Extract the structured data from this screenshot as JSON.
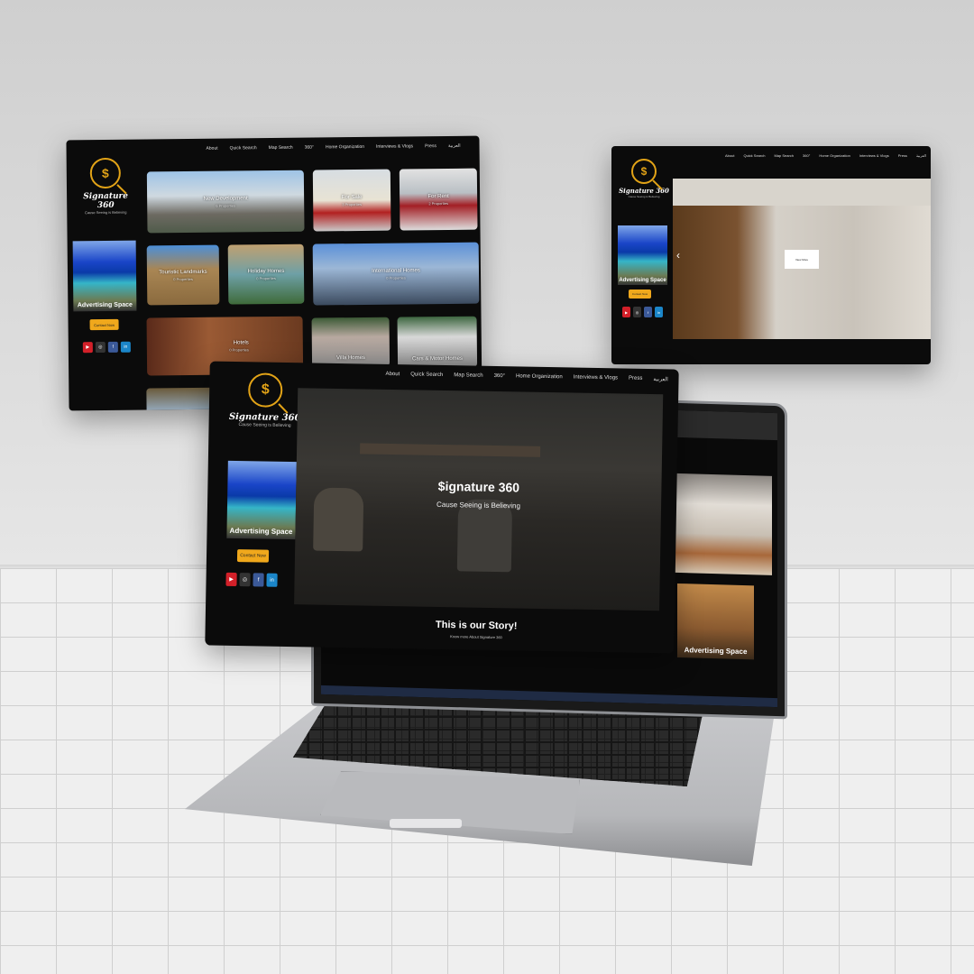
{
  "site": {
    "brand": "Signature 360",
    "tagline": "Cause Seeing is Believing",
    "hero_title": "$ignature 360",
    "hero_subtitle": "Cause Seeing is Believing",
    "story_title": "This is our Story!",
    "story_subtitle": "Know more About Signature 360",
    "logo_symbol": "$"
  },
  "nav": [
    "About",
    "Quick Search",
    "Map Search",
    "360°",
    "Home Organization",
    "Interviews & Vlogs",
    "Press",
    "العربية"
  ],
  "sidebar": {
    "ad_label": "Advertising Space",
    "contact_label": "Contact Now",
    "socials": [
      {
        "name": "youtube",
        "glyph": "▶",
        "color": "#d32029"
      },
      {
        "name": "instagram",
        "glyph": "◎",
        "color": "#333333"
      },
      {
        "name": "facebook",
        "glyph": "f",
        "color": "#3b5998"
      },
      {
        "name": "linkedin",
        "glyph": "in",
        "color": "#1b86c9"
      }
    ]
  },
  "categories": [
    {
      "label": "New Development",
      "count": "6 Properties"
    },
    {
      "label": "For Sale",
      "count": "3 Properties"
    },
    {
      "label": "For Rent",
      "count": "2 Properties"
    },
    {
      "label": "Touristic Landmarks",
      "count": "0 Properties"
    },
    {
      "label": "Holiday Homes",
      "count": "0 Properties"
    },
    {
      "label": "International Homes",
      "count": "0 Properties"
    },
    {
      "label": "Hotels",
      "count": "0 Properties"
    },
    {
      "label": "Villa Homes",
      "count": ""
    },
    {
      "label": "Cars & Motor Homes",
      "count": ""
    }
  ],
  "slider": {
    "button_label": "View More",
    "prev": "‹"
  },
  "laptop_side": {
    "ad_label": "Advertising Space"
  },
  "colors": {
    "accent": "#f0a81c",
    "background": "#0b0b0b"
  }
}
